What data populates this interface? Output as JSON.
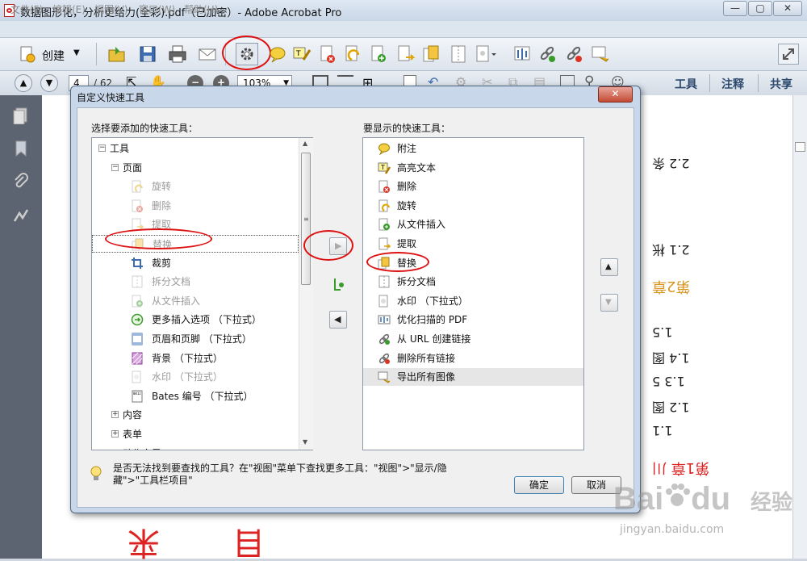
{
  "window": {
    "title": "数据图形化，分析更给力(全彩).pdf（已加密）- Adobe Acrobat Pro"
  },
  "menu": [
    "文件(F)",
    "编辑(E)",
    "视图(V)",
    "窗口(W)",
    "帮助(H)"
  ],
  "toolbar": {
    "create_label": "创建"
  },
  "nav": {
    "page_input": "4",
    "page_total": "/ 62",
    "zoom": "103%"
  },
  "right_panel_tabs": [
    "工具",
    "注释",
    "共享"
  ],
  "document": {
    "reversed_texts": [
      "2.2 条",
      "2.1 枨",
      "第2章",
      "1.5",
      "1.4 图",
      "1.3 5",
      "1.2 图",
      "1.1",
      "第1章 川"
    ]
  },
  "dialog": {
    "title": "自定义快速工具",
    "close_label": "✕",
    "left_label": "选择要添加的快速工具：",
    "right_label": "要显示的快速工具：",
    "hint": "是否无法找到要查找的工具？在\"视图\"菜单下查找更多工具：\"视图\">\"显示/隐藏\">\"工具栏项目\"",
    "ok_label": "确定",
    "cancel_label": "取消",
    "left_tree": [
      {
        "label": "工具",
        "level": 0,
        "expander": "−",
        "icon": "none",
        "enabled": true
      },
      {
        "label": "页面",
        "level": 1,
        "expander": "−",
        "icon": "none",
        "enabled": true
      },
      {
        "label": "旋转",
        "level": 2,
        "icon": "rotate-page",
        "enabled": false
      },
      {
        "label": "删除",
        "level": 2,
        "icon": "delete-page",
        "enabled": false
      },
      {
        "label": "提取",
        "level": 2,
        "icon": "extract-page",
        "enabled": false
      },
      {
        "label": "替换",
        "level": 2,
        "icon": "replace-page",
        "enabled": false,
        "selected": true
      },
      {
        "label": "裁剪",
        "level": 2,
        "icon": "crop",
        "enabled": true
      },
      {
        "label": "拆分文档",
        "level": 2,
        "icon": "split-document",
        "enabled": false
      },
      {
        "label": "从文件插入",
        "level": 2,
        "icon": "insert-from-file",
        "enabled": false
      },
      {
        "label": "更多插入选项 （下拉式）",
        "level": 2,
        "icon": "more-insert",
        "enabled": true
      },
      {
        "label": "页眉和页脚 （下拉式）",
        "level": 2,
        "icon": "header-footer",
        "enabled": true
      },
      {
        "label": "背景 （下拉式）",
        "level": 2,
        "icon": "background",
        "enabled": true
      },
      {
        "label": "水印 （下拉式）",
        "level": 2,
        "icon": "watermark",
        "enabled": false
      },
      {
        "label": "Bates 编号 （下拉式）",
        "level": 2,
        "icon": "bates",
        "enabled": true
      },
      {
        "label": "内容",
        "level": 1,
        "expander": "+",
        "icon": "none",
        "enabled": true
      },
      {
        "label": "表单",
        "level": 1,
        "expander": "+",
        "icon": "none",
        "enabled": true
      },
      {
        "label": "动作向导",
        "level": 1,
        "expander": "−",
        "icon": "none",
        "enabled": true
      }
    ],
    "right_list": [
      {
        "label": "附注",
        "icon": "sticky-note"
      },
      {
        "label": "高亮文本",
        "icon": "highlight-text"
      },
      {
        "label": "删除",
        "icon": "delete-page"
      },
      {
        "label": "旋转",
        "icon": "rotate-page"
      },
      {
        "label": "从文件插入",
        "icon": "insert-from-file"
      },
      {
        "label": "提取",
        "icon": "extract-page"
      },
      {
        "label": "替换",
        "icon": "replace-page"
      },
      {
        "label": "拆分文档",
        "icon": "split-document"
      },
      {
        "label": "水印 （下拉式）",
        "icon": "watermark"
      },
      {
        "label": "优化扫描的 PDF",
        "icon": "optimize-scan"
      },
      {
        "label": "从 URL 创建链接",
        "icon": "create-link"
      },
      {
        "label": "删除所有链接",
        "icon": "remove-links"
      },
      {
        "label": "导出所有图像",
        "icon": "export-images",
        "selected": true
      }
    ]
  },
  "watermark": {
    "brand": "Bai",
    "brand2": "du",
    "site_cn": "经验",
    "url": "jingyan.baidu.com"
  },
  "colors": {
    "annotation_red": "#d11111",
    "selection": "#e6e6e6"
  }
}
